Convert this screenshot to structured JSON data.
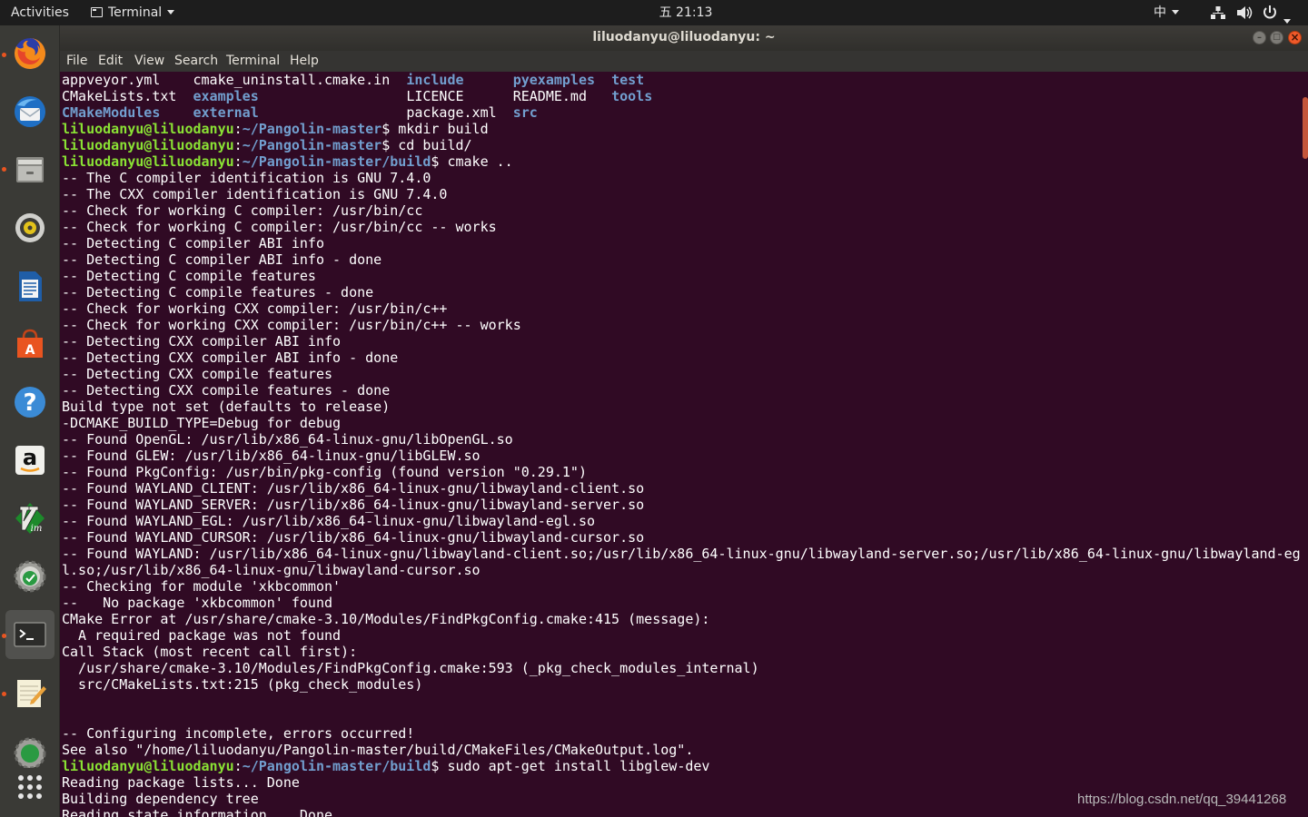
{
  "topbar": {
    "activities": "Activities",
    "app_menu": "Terminal",
    "clock": "五 21:13",
    "input_method": "中"
  },
  "window": {
    "title": "liluodanyu@liluodanyu: ~"
  },
  "menubar": {
    "file": "File",
    "edit": "Edit",
    "view": "View",
    "search": "Search",
    "terminal": "Terminal",
    "help": "Help"
  },
  "dock": {
    "items": [
      {
        "name": "firefox",
        "running": true
      },
      {
        "name": "thunderbird",
        "running": false
      },
      {
        "name": "files",
        "running": true
      },
      {
        "name": "rhythmbox",
        "running": false
      },
      {
        "name": "libreoffice-writer",
        "running": false
      },
      {
        "name": "software-center",
        "running": false
      },
      {
        "name": "help",
        "running": false
      },
      {
        "name": "amazon",
        "running": false
      },
      {
        "name": "vim",
        "running": false
      },
      {
        "name": "software-updater",
        "running": false
      },
      {
        "name": "terminal",
        "running": true
      },
      {
        "name": "text-editor",
        "running": true
      },
      {
        "name": "settings",
        "running": false
      },
      {
        "name": "show-applications",
        "running": false
      }
    ]
  },
  "terminal": {
    "prompt_user": "liluodanyu@liluodanyu",
    "ls_rows": [
      [
        {
          "t": "appveyor.yml    ",
          "c": "f"
        },
        {
          "t": "cmake_uninstall.cmake.in  ",
          "c": "f"
        },
        {
          "t": "include",
          "c": "d"
        },
        {
          "t": "      ",
          "c": "f"
        },
        {
          "t": "pyexamples",
          "c": "d"
        },
        {
          "t": "  ",
          "c": "f"
        },
        {
          "t": "test",
          "c": "d"
        }
      ],
      [
        {
          "t": "CMakeLists.txt  ",
          "c": "f"
        },
        {
          "t": "examples",
          "c": "d"
        },
        {
          "t": "                  ",
          "c": "f"
        },
        {
          "t": "LICENCE      ",
          "c": "f"
        },
        {
          "t": "README.md   ",
          "c": "f"
        },
        {
          "t": "tools",
          "c": "d"
        }
      ],
      [
        {
          "t": "CMakeModules",
          "c": "d"
        },
        {
          "t": "    ",
          "c": "f"
        },
        {
          "t": "external",
          "c": "d"
        },
        {
          "t": "                  ",
          "c": "f"
        },
        {
          "t": "package.xml  ",
          "c": "f"
        },
        {
          "t": "src",
          "c": "d"
        }
      ]
    ],
    "commands_before": [
      {
        "path": "~/Pangolin-master",
        "cmd": "mkdir build"
      },
      {
        "path": "~/Pangolin-master",
        "cmd": "cd build/"
      },
      {
        "path": "~/Pangolin-master/build",
        "cmd": "cmake .."
      }
    ],
    "output": [
      "-- The C compiler identification is GNU 7.4.0",
      "-- The CXX compiler identification is GNU 7.4.0",
      "-- Check for working C compiler: /usr/bin/cc",
      "-- Check for working C compiler: /usr/bin/cc -- works",
      "-- Detecting C compiler ABI info",
      "-- Detecting C compiler ABI info - done",
      "-- Detecting C compile features",
      "-- Detecting C compile features - done",
      "-- Check for working CXX compiler: /usr/bin/c++",
      "-- Check for working CXX compiler: /usr/bin/c++ -- works",
      "-- Detecting CXX compiler ABI info",
      "-- Detecting CXX compiler ABI info - done",
      "-- Detecting CXX compile features",
      "-- Detecting CXX compile features - done",
      "Build type not set (defaults to release)",
      "-DCMAKE_BUILD_TYPE=Debug for debug",
      "-- Found OpenGL: /usr/lib/x86_64-linux-gnu/libOpenGL.so",
      "-- Found GLEW: /usr/lib/x86_64-linux-gnu/libGLEW.so",
      "-- Found PkgConfig: /usr/bin/pkg-config (found version \"0.29.1\")",
      "-- Found WAYLAND_CLIENT: /usr/lib/x86_64-linux-gnu/libwayland-client.so",
      "-- Found WAYLAND_SERVER: /usr/lib/x86_64-linux-gnu/libwayland-server.so",
      "-- Found WAYLAND_EGL: /usr/lib/x86_64-linux-gnu/libwayland-egl.so",
      "-- Found WAYLAND_CURSOR: /usr/lib/x86_64-linux-gnu/libwayland-cursor.so",
      "-- Found WAYLAND: /usr/lib/x86_64-linux-gnu/libwayland-client.so;/usr/lib/x86_64-linux-gnu/libwayland-server.so;/usr/lib/x86_64-linux-gnu/libwayland-eg",
      "l.so;/usr/lib/x86_64-linux-gnu/libwayland-cursor.so",
      "-- Checking for module 'xkbcommon'",
      "--   No package 'xkbcommon' found",
      "CMake Error at /usr/share/cmake-3.10/Modules/FindPkgConfig.cmake:415 (message):",
      "  A required package was not found",
      "Call Stack (most recent call first):",
      "  /usr/share/cmake-3.10/Modules/FindPkgConfig.cmake:593 (_pkg_check_modules_internal)",
      "  src/CMakeLists.txt:215 (pkg_check_modules)",
      "",
      "",
      "-- Configuring incomplete, errors occurred!",
      "See also \"/home/liluodanyu/Pangolin-master/build/CMakeFiles/CMakeOutput.log\"."
    ],
    "command_after": {
      "path": "~/Pangolin-master/build",
      "cmd": "sudo apt-get install libglew-dev"
    },
    "output_after": [
      "Reading package lists... Done",
      "Building dependency tree",
      "Reading state information... Done"
    ]
  },
  "watermark": "https://blog.csdn.net/qq_39441268"
}
